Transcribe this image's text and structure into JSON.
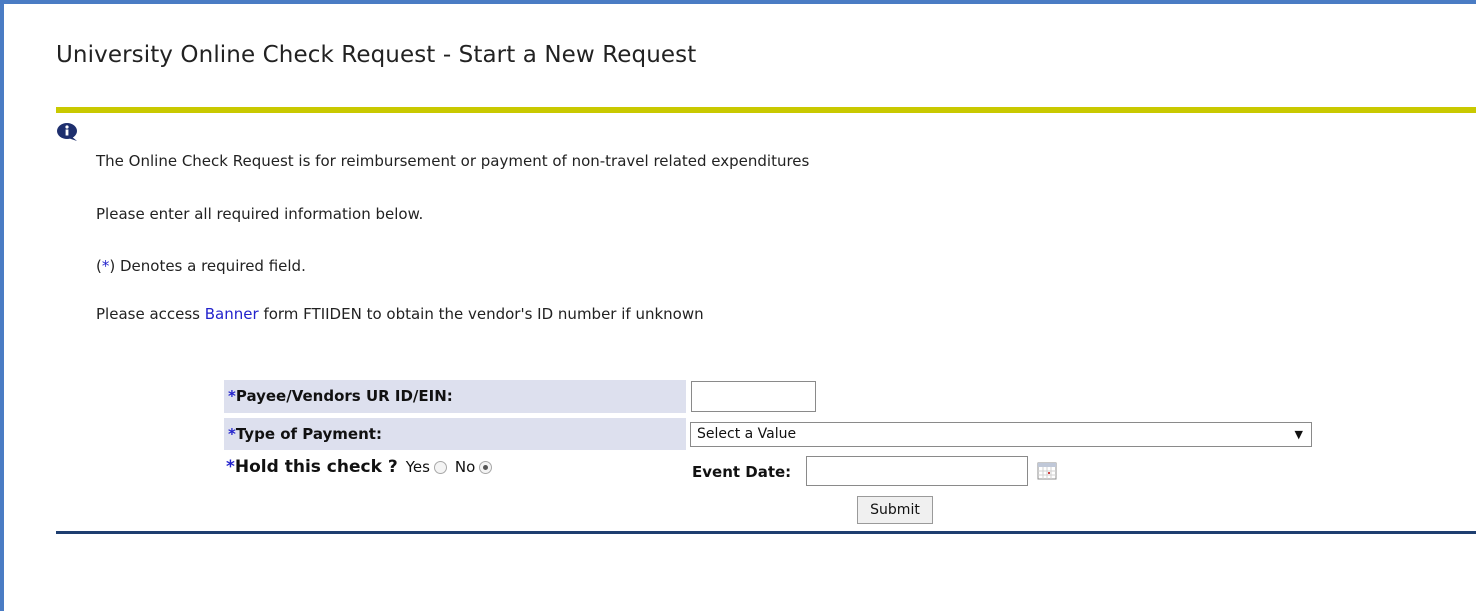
{
  "page": {
    "title": "University Online Check Request - Start a New Request"
  },
  "info": {
    "line1": "The Online Check Request is for reimbursement or payment of non-travel related expenditures",
    "line2": "Please enter all required information below.",
    "line3_prefix": "(",
    "line3_star": "*",
    "line3_suffix": ") Denotes a required field.",
    "line4_prefix": "Please access ",
    "line4_link": "Banner",
    "line4_suffix": " form FTIIDEN to obtain the vendor's ID number if unknown"
  },
  "form": {
    "required_mark": "*",
    "payee_label": "Payee/Vendors UR ID/EIN:",
    "payee_value": "",
    "payment_label": "Type of Payment:",
    "payment_selected": "Select a Value",
    "hold_label": "Hold this check ?",
    "hold_yes": "Yes",
    "hold_no": "No",
    "hold_selected": "No",
    "event_date_label": "Event Date:",
    "event_date_value": "",
    "submit_label": "Submit"
  },
  "colors": {
    "frame": "#4a7cc4",
    "title_rule": "#c9c900",
    "label_bg": "#dde0ee",
    "required": "#2222cc",
    "footer_rule": "#1e3e70"
  },
  "icons": {
    "info": "info-icon",
    "calendar": "calendar-icon",
    "dropdown": "chevron-down-icon"
  }
}
